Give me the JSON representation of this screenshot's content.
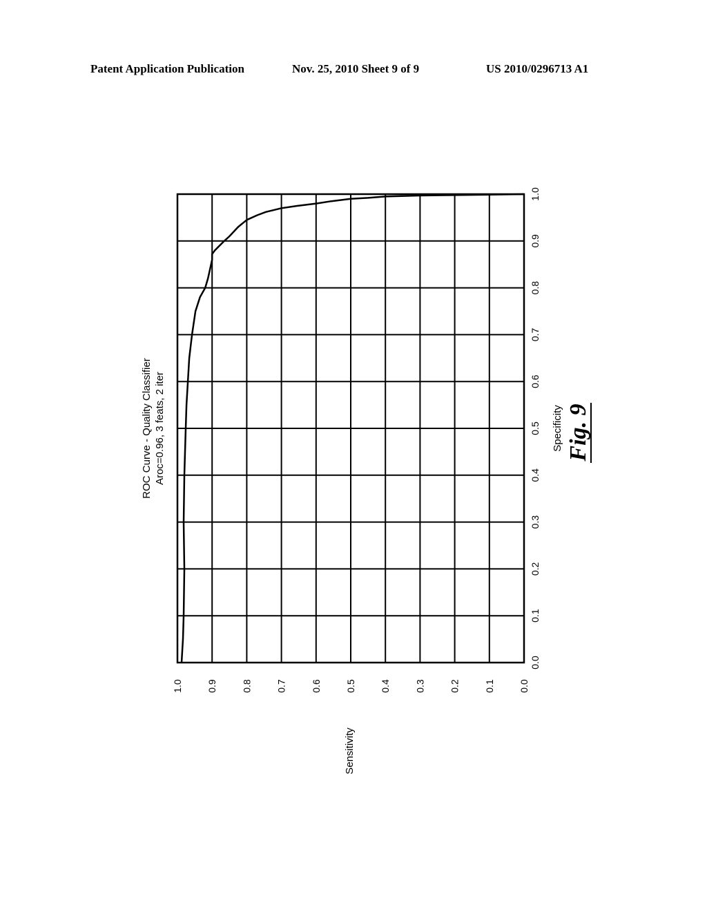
{
  "header": {
    "publication": "Patent Application Publication",
    "date_sheet": "Nov. 25, 2010   Sheet 9 of 9",
    "patent_number": "US 2010/0296713 A1"
  },
  "figure": {
    "label": "Fig. 9",
    "orientation": "rotated 90° counter-clockwise"
  },
  "chart_data": {
    "type": "line",
    "title": "ROC Curve - Quality Classifier",
    "subtitle": "Aroc=0.96, 3 feats, 2 iter",
    "xlabel": "Specificity",
    "ylabel": "Sensitivity",
    "xlim": [
      0.0,
      1.0
    ],
    "ylim": [
      0.0,
      1.0
    ],
    "x_ticks": [
      "0.0",
      "0.1",
      "0.2",
      "0.3",
      "0.4",
      "0.5",
      "0.6",
      "0.7",
      "0.8",
      "0.9",
      "1.0"
    ],
    "y_ticks": [
      "1.0",
      "0.9",
      "0.8",
      "0.7",
      "0.6",
      "0.5",
      "0.4",
      "0.3",
      "0.2",
      "0.1",
      "0.0"
    ],
    "grid": true,
    "legend": "none",
    "series": [
      {
        "name": "ROC",
        "points": [
          [
            0.0,
            0.988
          ],
          [
            0.05,
            0.984
          ],
          [
            0.1,
            0.982
          ],
          [
            0.2,
            0.98
          ],
          [
            0.3,
            0.982
          ],
          [
            0.4,
            0.98
          ],
          [
            0.5,
            0.976
          ],
          [
            0.55,
            0.974
          ],
          [
            0.6,
            0.97
          ],
          [
            0.65,
            0.966
          ],
          [
            0.7,
            0.958
          ],
          [
            0.75,
            0.948
          ],
          [
            0.78,
            0.935
          ],
          [
            0.8,
            0.92
          ],
          [
            0.82,
            0.912
          ],
          [
            0.84,
            0.906
          ],
          [
            0.86,
            0.9
          ],
          [
            0.872,
            0.9
          ],
          [
            0.88,
            0.892
          ],
          [
            0.9,
            0.865
          ],
          [
            0.91,
            0.85
          ],
          [
            0.93,
            0.825
          ],
          [
            0.945,
            0.8
          ],
          [
            0.955,
            0.77
          ],
          [
            0.962,
            0.745
          ],
          [
            0.97,
            0.7
          ],
          [
            0.975,
            0.655
          ],
          [
            0.98,
            0.6
          ],
          [
            0.985,
            0.556
          ],
          [
            0.99,
            0.5
          ],
          [
            0.992,
            0.45
          ],
          [
            0.995,
            0.4
          ],
          [
            0.997,
            0.3
          ],
          [
            0.998,
            0.2
          ],
          [
            0.999,
            0.1
          ],
          [
            1.0,
            0.0
          ]
        ]
      }
    ]
  }
}
